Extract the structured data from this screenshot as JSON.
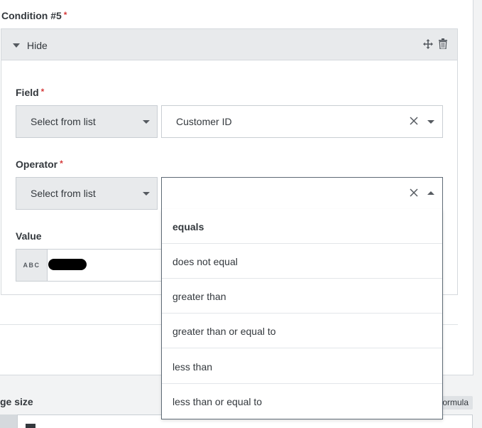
{
  "condition": {
    "label": "Condition #5",
    "required_mark": "*",
    "action": "Hide",
    "icons": {
      "collapse": "caret-down-icon",
      "move": "move-icon",
      "delete": "trash-icon"
    }
  },
  "field": {
    "label": "Field",
    "required_mark": "*",
    "source": "Select from list",
    "value": "Customer ID"
  },
  "operator": {
    "label": "Operator",
    "required_mark": "*",
    "source": "Select from list",
    "value": "",
    "options": [
      "equals",
      "does not equal",
      "greater than",
      "greater than or equal to",
      "less than",
      "less than or equal to"
    ],
    "highlighted_index": 0
  },
  "value": {
    "label": "Value",
    "type_badge": "ABC"
  },
  "page_size": {
    "label": "ge size",
    "formula_label": "ormula"
  },
  "colors": {
    "required": "#d63b3b",
    "header_bg": "#e8eaec",
    "border": "#c9ced3",
    "text": "#33383d"
  }
}
